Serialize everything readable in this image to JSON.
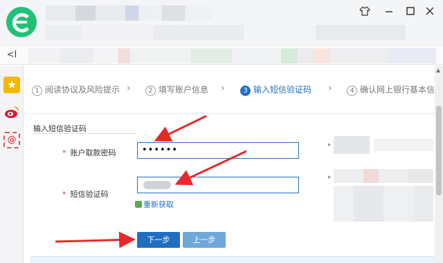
{
  "window": {
    "minimize_icon": "minimize-icon",
    "maximize_icon": "maximize-icon",
    "close_icon": "close-icon"
  },
  "nav": {
    "back_label": "<I"
  },
  "steps": [
    {
      "num": "1",
      "label": "阅读协议及风险提示"
    },
    {
      "num": "2",
      "label": "填写账户信息"
    },
    {
      "num": "3",
      "label": "输入短信验证码"
    },
    {
      "num": "4",
      "label": "确认网上银行基本信"
    }
  ],
  "step_separator": "›",
  "form": {
    "section_title": "输入短信验证码",
    "password_label": "账户取款密码",
    "password_value": "••••••",
    "sms_label": "短信验证码",
    "required_mark": "*",
    "refresh_label": "重新获取"
  },
  "buttons": {
    "next": "下一步",
    "prev": "上一步"
  },
  "rail": {
    "star": "★",
    "weibo": "◉",
    "mail": "@"
  },
  "colors": {
    "accent": "#1f6fc1",
    "accent_light": "#6fa7db",
    "arrow_red": "#e8282b",
    "brand_green": "#21c17a"
  }
}
